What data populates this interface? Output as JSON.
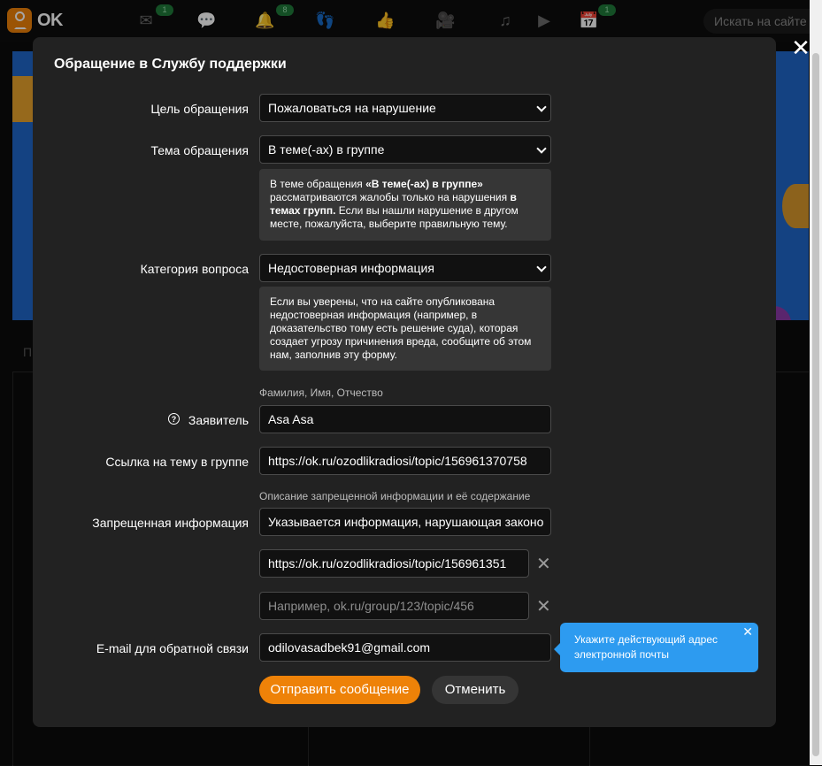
{
  "topbar": {
    "logo": "OK",
    "icons": [
      {
        "name": "messages-icon",
        "badge": "1"
      },
      {
        "name": "discussions-icon",
        "badge": ""
      },
      {
        "name": "notifications-icon",
        "badge": "8"
      },
      {
        "name": "guests-icon",
        "badge": ""
      },
      {
        "name": "events-icon",
        "badge": ""
      },
      {
        "name": "video-icon",
        "badge": ""
      },
      {
        "name": "music-icon",
        "badge": ""
      },
      {
        "name": "play-icon",
        "badge": ""
      },
      {
        "name": "calendar-icon",
        "badge": "1"
      }
    ],
    "search_placeholder": "Искать на сайте"
  },
  "background": {
    "side_letter": "П"
  },
  "modal": {
    "title": "Обращение в Службу поддержки",
    "purpose": {
      "label": "Цель обращения",
      "value": "Пожаловаться на нарушение"
    },
    "topic": {
      "label": "Тема обращения",
      "value": "В теме(-ах) в группе"
    },
    "topic_info": {
      "p1": "В теме обращения ",
      "b1": "«В теме(-ах) в группе»",
      "p2": " рассматриваются жалобы только на нарушения ",
      "b2": "в темах групп.",
      "p3": " Если вы нашли нарушение в другом месте, пожалуйста, выберите правильную тему."
    },
    "category": {
      "label": "Категория вопроса",
      "value": "Недостоверная информация"
    },
    "category_info": "Если вы уверены, что на сайте опубликована недостоверная информация (например, в доказательство тому есть решение суда), которая создает угрозу причинения вреда, сообщите об этом нам, заполнив эту форму.",
    "applicant_hint": "Фамилия, Имя, Отчество",
    "applicant": {
      "label": "Заявитель",
      "value": "Asa Asa"
    },
    "topic_link": {
      "label": "Ссылка на тему в группе",
      "value": "https://ok.ru/ozodlikradiosi/topic/156961370758"
    },
    "forbidden_hint": "Описание запрещенной информации и её содержание",
    "forbidden": {
      "label": "Запрещенная информация",
      "value": "Указывается информация, нарушающая законо"
    },
    "link_1": "https://ok.ru/ozodlikradiosi/topic/156961351",
    "link_2_placeholder": "Например, ok.ru/group/123/topic/456",
    "email": {
      "label": "E-mail для обратной связи",
      "value": "odilovasadbek91@gmail.com"
    },
    "send_button": "Отправить сообщение",
    "cancel_button": "Отменить"
  },
  "tooltip": {
    "text": "Укажите действующий адрес электронной почты"
  },
  "colors": {
    "accent": "#ee8208",
    "tooltip": "#2d9bf0",
    "modal_bg": "#222222",
    "info_bg": "#363636"
  }
}
